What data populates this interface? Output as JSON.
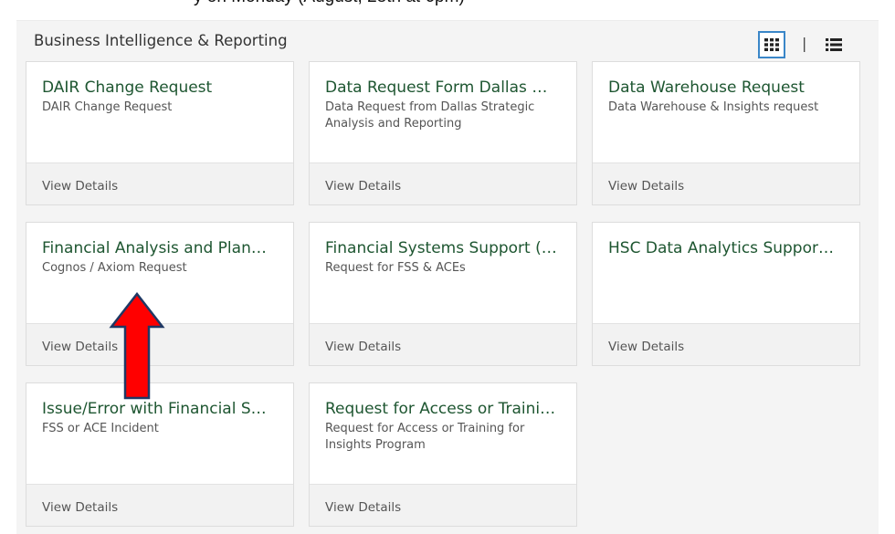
{
  "caption": "y on Monday (August, 28th at 6pm)",
  "section": {
    "title": "Business Intelligence & Reporting"
  },
  "view_toggle": {
    "grid_icon": "grid-view-icon",
    "separator": "|",
    "list_icon": "list-view-icon",
    "active": "grid"
  },
  "cards": [
    {
      "title": "DAIR Change Request",
      "description": "DAIR Change Request",
      "link": "View Details"
    },
    {
      "title": "Data Request Form Dallas …",
      "description": "Data Request from Dallas Strategic Analysis and Reporting",
      "link": "View Details"
    },
    {
      "title": "Data Warehouse Request",
      "description": "Data Warehouse & Insights request",
      "link": "View Details"
    },
    {
      "title": "Financial Analysis and Plan…",
      "description": "Cognos / Axiom Request",
      "link": "View Details"
    },
    {
      "title": "Financial Systems Support (…",
      "description": "Request for FSS & ACEs",
      "link": "View Details"
    },
    {
      "title": "HSC Data Analytics Suppor…",
      "description": "",
      "link": "View Details"
    },
    {
      "title": "Issue/Error with Financial S…",
      "description": "FSS or ACE Incident",
      "link": "View Details"
    },
    {
      "title": "Request for Access or Traini…",
      "description": "Request for Access or Training for Insights Program",
      "link": "View Details"
    }
  ],
  "colors": {
    "title_green": "#1e5631",
    "toggle_blue": "#3a86c8",
    "annotation_red": "#ff0000",
    "annotation_outline": "#1f3864"
  }
}
